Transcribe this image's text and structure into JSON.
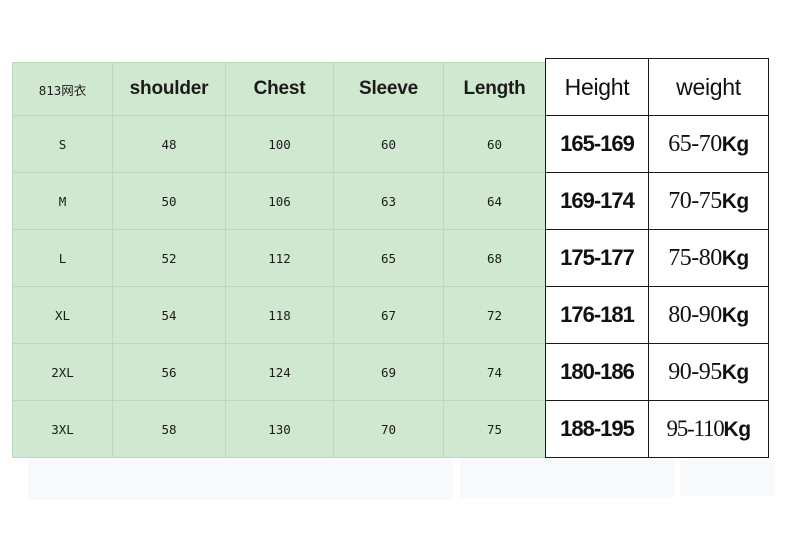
{
  "document": {
    "kind": "apparel-size-chart",
    "colors": {
      "cell_green": "#d0e8cf",
      "green_gridline": "#bcd7bb",
      "table_border_black": "#1a1a1a",
      "text_dark": "#1b1b1b",
      "page_background": "#ffffff"
    }
  },
  "size_table": {
    "headers": {
      "model": "813网衣",
      "shoulder": "shoulder",
      "chest": "Chest",
      "sleeve": "Sleeve",
      "length": "Length"
    },
    "rows": [
      {
        "size": "S",
        "shoulder": "48",
        "chest": "100",
        "sleeve": "60",
        "length": "60"
      },
      {
        "size": "M",
        "shoulder": "50",
        "chest": "106",
        "sleeve": "63",
        "length": "64"
      },
      {
        "size": "L",
        "shoulder": "52",
        "chest": "112",
        "sleeve": "65",
        "length": "68"
      },
      {
        "size": "XL",
        "shoulder": "54",
        "chest": "118",
        "sleeve": "67",
        "length": "72"
      },
      {
        "size": "2XL",
        "shoulder": "56",
        "chest": "124",
        "sleeve": "69",
        "length": "74"
      },
      {
        "size": "3XL",
        "shoulder": "58",
        "chest": "130",
        "sleeve": "70",
        "length": "75"
      }
    ]
  },
  "fit_table": {
    "headers": {
      "height": "Height",
      "weight": "weight"
    },
    "rows": [
      {
        "height": "165-169",
        "weight_range": "65-70",
        "weight_unit": "Kg"
      },
      {
        "height": "169-174",
        "weight_range": "70-75",
        "weight_unit": "Kg"
      },
      {
        "height": "175-177",
        "weight_range": "75-80",
        "weight_unit": "Kg"
      },
      {
        "height": "176-181",
        "weight_range": "80-90",
        "weight_unit": "Kg"
      },
      {
        "height": "180-186",
        "weight_range": "90-95",
        "weight_unit": "Kg"
      },
      {
        "height": "188-195",
        "weight_range": "95-110",
        "weight_unit": "Kg"
      }
    ]
  }
}
